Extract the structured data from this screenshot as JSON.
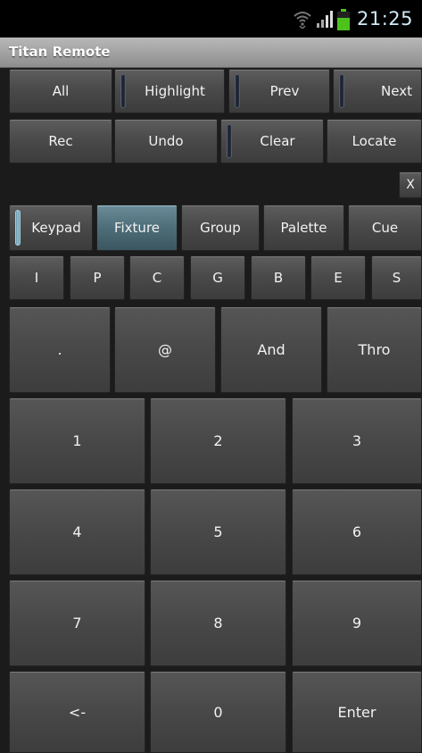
{
  "status_bar": {
    "time": "21:25",
    "icons": [
      "wifi-icon",
      "signal-icon",
      "battery-icon"
    ],
    "battery_color": "#4dc21a"
  },
  "app": {
    "title": "Titan Remote"
  },
  "row1": [
    {
      "label": "All",
      "indicator": false
    },
    {
      "label": "Highlight",
      "indicator": true,
      "indicator_on": false
    },
    {
      "label": "Prev",
      "indicator": true,
      "indicator_on": false
    },
    {
      "label": "Next",
      "indicator": true,
      "indicator_on": false
    }
  ],
  "row2": [
    {
      "label": "Rec",
      "indicator": false
    },
    {
      "label": "Undo",
      "indicator": false
    },
    {
      "label": "Clear",
      "indicator": true,
      "indicator_on": false
    },
    {
      "label": "Locate",
      "indicator": false
    }
  ],
  "close_button": {
    "label": "X"
  },
  "mode_tabs": [
    {
      "label": "Keypad",
      "indicator": true,
      "indicator_on": true,
      "active": false
    },
    {
      "label": "Fixture",
      "active": true
    },
    {
      "label": "Group",
      "active": false
    },
    {
      "label": "Palette",
      "active": false
    },
    {
      "label": "Cue",
      "active": false
    }
  ],
  "letter_keys": [
    "I",
    "P",
    "C",
    "G",
    "B",
    "E",
    "S"
  ],
  "operator_keys": [
    ".",
    "@",
    "And",
    "Thro"
  ],
  "keypad_rows": [
    [
      "1",
      "2",
      "3"
    ],
    [
      "4",
      "5",
      "6"
    ],
    [
      "7",
      "8",
      "9"
    ],
    [
      "<-",
      "0",
      "Enter"
    ]
  ],
  "colors": {
    "background": "#1b1b1b",
    "button": "#4a4a4a",
    "active_tab": "#4d6e79",
    "titlebar": "#a3a3a3"
  }
}
